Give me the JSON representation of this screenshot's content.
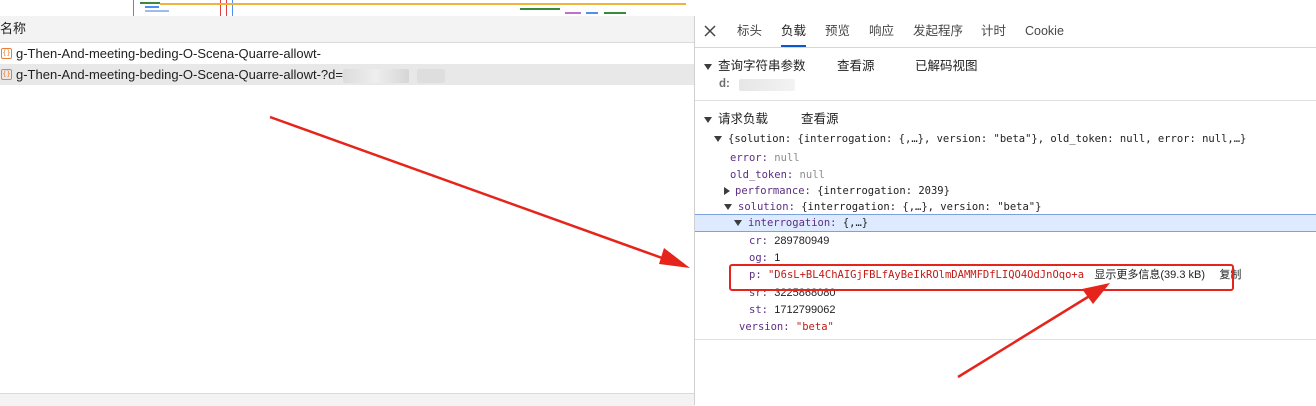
{
  "network_list": {
    "header_label": "名称",
    "rows": [
      {
        "name": "g-Then-And-meeting-beding-O-Scena-Quarre-allowt-"
      },
      {
        "name": "g-Then-And-meeting-beding-O-Scena-Quarre-allowt-?d="
      }
    ]
  },
  "tabs": [
    "标头",
    "负载",
    "预览",
    "响应",
    "发起程序",
    "计时",
    "Cookie"
  ],
  "query_section": {
    "title": "查询字符串参数",
    "view_source": "查看源",
    "view_decoded": "已解码视图",
    "param_key": "d:"
  },
  "payload_section": {
    "title": "请求负载",
    "view_source": "查看源",
    "root_summary": "{solution: {interrogation: {,…}, version: \"beta\"}, old_token: null, error: null,…}",
    "error_key": "error:",
    "error_val": "null",
    "old_token_key": "old_token:",
    "old_token_val": "null",
    "performance_key": "performance:",
    "performance_val": "{interrogation: 2039}",
    "solution_key": "solution:",
    "solution_val": "{interrogation: {,…}, version: \"beta\"}",
    "interrogation_key": "interrogation:",
    "interrogation_val": "{,…}",
    "cr_key": "cr:",
    "cr_val": "289780949",
    "og_key": "og:",
    "og_val": "1",
    "p_key": "p:",
    "p_val": "\"D6sL+BL4ChAIGjFBLfAyBeIkROlmDAMMFDfLIQO4OdJnOqo+a",
    "show_more": "显示更多信息(39.3 kB)",
    "copy": "复制",
    "sr_key": "sr:",
    "sr_val": "3225868080",
    "st_key": "st:",
    "st_val": "1712799062",
    "version_key": "version:",
    "version_val": "\"beta\""
  },
  "colors": {
    "active_tab": "#0b57d0",
    "annotation_red": "#e5251c",
    "key_purple": "#881280",
    "string_red": "#c41a16",
    "number_blue": "#1a1aa6",
    "selected_row": "#ddeaff"
  }
}
